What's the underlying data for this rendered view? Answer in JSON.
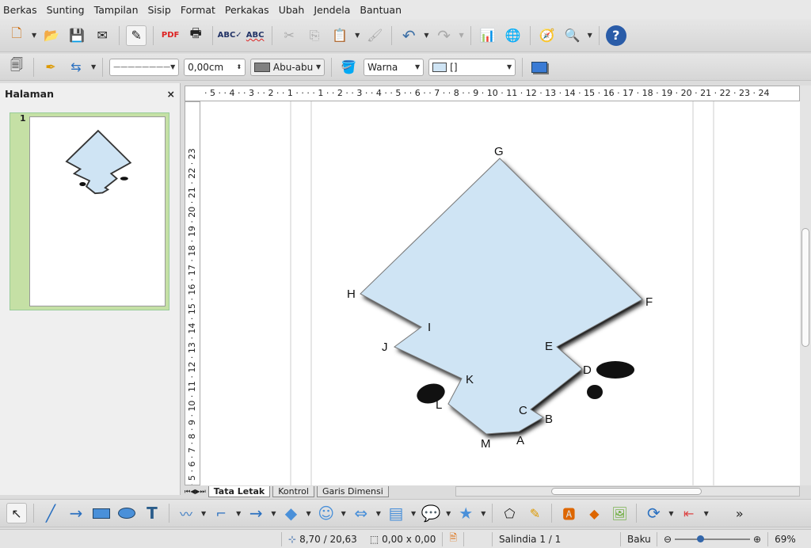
{
  "menu": [
    "Berkas",
    "Sunting",
    "Tampilan",
    "Sisip",
    "Format",
    "Perkakas",
    "Ubah",
    "Jendela",
    "Bantuan"
  ],
  "toolbar2": {
    "line_style": "————————",
    "line_width": "0,00cm",
    "line_color": "Abu-abu",
    "area_style": "Warna",
    "area_color": "[]"
  },
  "panel": {
    "title": "Halaman",
    "close": "×",
    "page_number": "1"
  },
  "ruler": {
    "horizontal": "· 5 · · 4 · · 3 · · 2 · · 1 · ·   · · 1 · · 2 · · 3 · · 4 · · 5 · · 6 · · 7 · · 8 · · 9 · 10 · 11 · 12 · 13 · 14 · 15 · 16 · 17 · 18 · 19 · 20 · 21 · 22 · 23 · 24",
    "vertical": "· 5 · 6 · 7 · 8 · 9 · 10 · 11 · 12 · 13 · 14 · 15 · 16 · 17 · 18 · 19 · 20 · 21 · 22 · 23"
  },
  "shape": {
    "fill": "#cfe4f4",
    "labels": [
      "G",
      "F",
      "E",
      "D",
      "C",
      "B",
      "A",
      "M",
      "L",
      "K",
      "J",
      "I",
      "H"
    ]
  },
  "tabs": [
    "Tata Letak",
    "Kontrol",
    "Garis Dimensi"
  ],
  "status": {
    "position": "8,70 / 20,63",
    "size": "0,00 x 0,00",
    "slide": "Salindia 1 / 1",
    "layout": "Baku",
    "zoom": "69%",
    "zoom_level": 69
  }
}
